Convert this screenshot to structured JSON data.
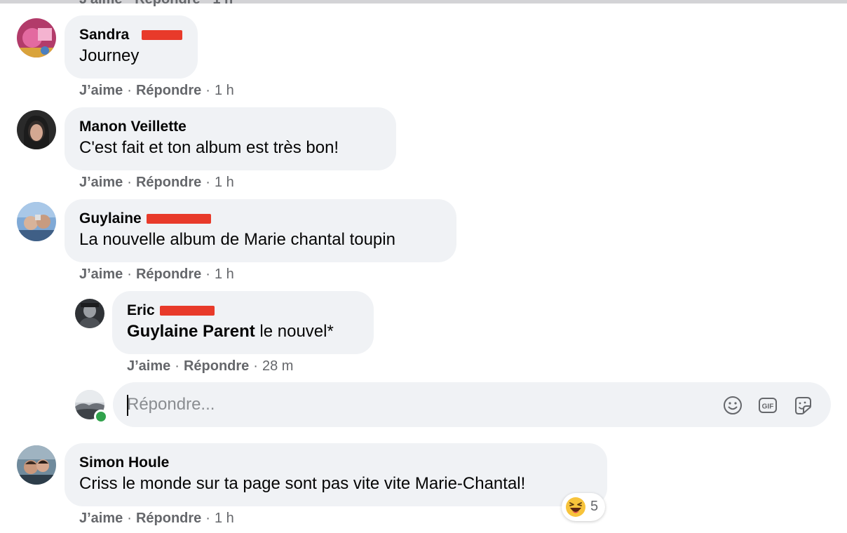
{
  "top_cutoff": "J'aime · Répondre · 1 h",
  "comments": [
    {
      "author": "Sandra",
      "text": "Journey",
      "like": "J’aime",
      "reply": "Répondre",
      "time": "1 h"
    },
    {
      "author": "Manon Veillette",
      "text": "C'est fait et ton album est très bon!",
      "like": "J’aime",
      "reply": "Répondre",
      "time": "1 h"
    },
    {
      "author": "Guylaine",
      "text": "La nouvelle album de Marie chantal toupin",
      "like": "J’aime",
      "reply": "Répondre",
      "time": "1 h"
    },
    {
      "author": "Simon Houle",
      "text": "Criss le monde sur ta page sont pas vite vite Marie-Chantal!",
      "like": "J’aime",
      "reply": "Répondre",
      "time": "1 h"
    }
  ],
  "reply": {
    "author": "Eric",
    "mention": "Guylaine Parent",
    "text": " le nouvel*",
    "like": "J’aime",
    "reply": "Répondre",
    "time": "28 m"
  },
  "composer": {
    "placeholder": "Répondre...",
    "icons": [
      "smiley-icon",
      "gif-icon",
      "sticker-icon"
    ]
  },
  "reaction": {
    "emoji": "laughing-emoji",
    "count": "5"
  },
  "colors": {
    "bubble": "#f0f2f5",
    "muted": "#65676b",
    "online": "#31a24c",
    "redaction": "#e83a2a"
  }
}
